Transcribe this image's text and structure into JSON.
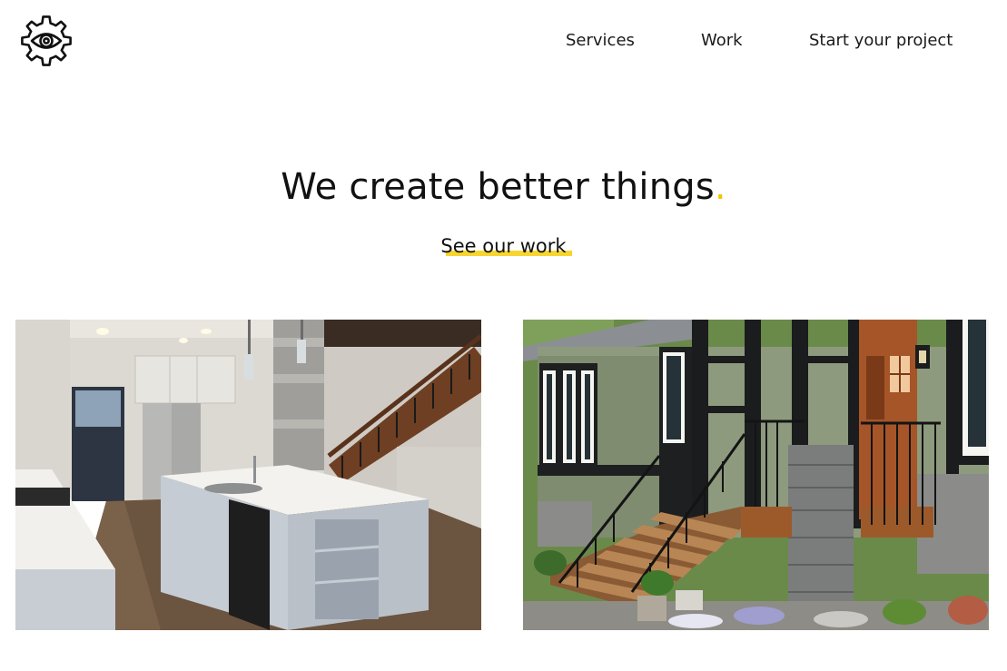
{
  "header": {
    "logo": {
      "icon": "eye-gear-icon"
    },
    "nav": {
      "items": [
        {
          "label": "Services"
        },
        {
          "label": "Work"
        },
        {
          "label": "Start your project"
        }
      ]
    }
  },
  "hero": {
    "title": "We create better things",
    "title_punct": ".",
    "link_label": "See our work",
    "accent_color": "#f4c400"
  },
  "gallery": {
    "items": [
      {
        "subject": "kitchen-interior-photo"
      },
      {
        "subject": "house-porch-photo"
      }
    ]
  },
  "colors": {
    "text": "#111111",
    "accent": "#f7d531",
    "background": "#ffffff"
  }
}
